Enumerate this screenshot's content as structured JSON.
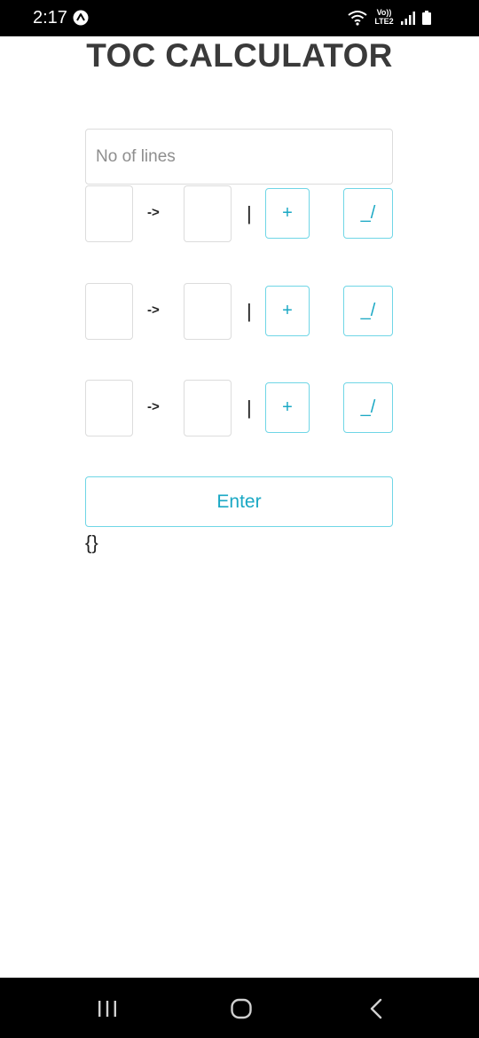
{
  "status_bar": {
    "time": "2:17",
    "network_label_top": "Vo))",
    "network_label_bottom": "LTE2"
  },
  "title": "TOC CALCULATOR",
  "lines_input": {
    "placeholder": "No of lines",
    "value": ""
  },
  "rules": [
    {
      "arrow": "->",
      "pipe": "|",
      "plus_label": "+",
      "epsilon_label": "_/"
    },
    {
      "arrow": "->",
      "pipe": "|",
      "plus_label": "+",
      "epsilon_label": "_/"
    },
    {
      "arrow": "->",
      "pipe": "|",
      "plus_label": "+",
      "epsilon_label": "_/"
    }
  ],
  "enter_button": {
    "label": "Enter"
  },
  "result": "{}",
  "colors": {
    "accent": "#1aa8c4",
    "accent_border": "#6fd6e6",
    "bar_background": "#000000"
  },
  "nav": {
    "recent_icon": "recent-apps-icon",
    "home_icon": "home-icon",
    "back_icon": "back-icon"
  }
}
